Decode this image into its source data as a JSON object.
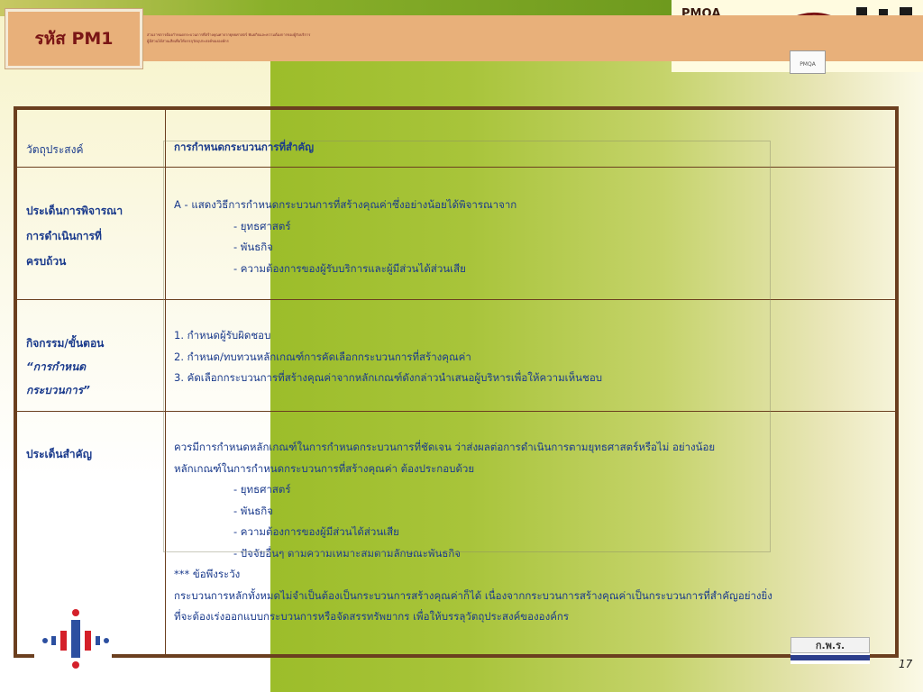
{
  "header": {
    "code_label": "รหัส PM1",
    "tiny_line1": "ส่วนราชการต้องกำหนดกระบวนการที่สร้างคุณค่าจากยุทธศาสตร์ พันธกิจและความต้องการของผู้รับบริการ",
    "tiny_line2": "ผู้มีส่วนได้ส่วนเสียเพื่อให้บรรลุวัตถุประสงค์ขององค์กร",
    "pmqa_label": "PMQA",
    "pmqa_logo_text": "PMQA"
  },
  "table": {
    "rows": [
      {
        "label": [
          "วัตถุประสงค์"
        ],
        "content": [
          "การกำหนดกระบวนการที่สำคัญ"
        ]
      },
      {
        "label": [
          "ประเด็นการพิจารณา",
          "การดำเนินการที่",
          "ครบถ้วน"
        ],
        "intro": "A - แสดงวิธีการกำหนดกระบวนการที่สร้างคุณค่าซึ่งอย่างน้อยได้พิจารณาจาก",
        "bullets": [
          "- ยุทธศาสตร์",
          "- พันธกิจ",
          "- ความต้องการของผู้รับบริการและผู้มีส่วนได้ส่วนเสีย"
        ]
      },
      {
        "label": [
          "กิจกรรม/ขั้นตอน"
        ],
        "label_italic": [
          "“การกำหนด",
          "กระบวนการ”"
        ],
        "steps": [
          "1. กำหนดผู้รับผิดชอบ",
          "2. กำหนด/ทบทวนหลักเกณฑ์การคัดเลือกกระบวนการที่สร้างคุณค่า",
          "3. คัดเลือกกระบวนการที่สร้างคุณค่าจากหลักเกณฑ์ดังกล่าวนำเสนอผู้บริหารเพื่อให้ความเห็นชอบ"
        ]
      },
      {
        "label": [
          "ประเด็นสำคัญ"
        ],
        "line1": "ควรมีการกำหนดหลักเกณฑ์ในการกำหนดกระบวนการที่ชัดเจน ว่าส่งผลต่อการดำเนินการตามยุทธศาสตร์หรือไม่ อย่างน้อย",
        "line2": "หลักเกณฑ์ในการกำหนดกระบวนการที่สร้างคุณค่า ต้องประกอบด้วย",
        "bullets": [
          "- ยุทธศาสตร์",
          "- พันธกิจ",
          "- ความต้องการของผู้มีส่วนได้ส่วนเสีย",
          "- ปัจจัยอื่นๆ ตามความเหมาะสมตามลักษณะพันธกิจ"
        ],
        "caution": "*** ข้อพึงระวัง",
        "line3": "กระบวนการหลักทั้งหมดไม่จำเป็นต้องเป็นกระบวนการสร้างคุณค่าก็ได้ เนื่องจากกระบวนการสร้างคุณค่าเป็นกระบวนการที่สำคัญอย่างยิ่ง",
        "line4": "ที่จะต้องเร่งออกแบบกระบวนการหรือจัดสรรทรัพยากร เพื่อให้บรรลุวัตถุประสงค์ขององค์กร"
      }
    ]
  },
  "footer": {
    "ocsc_text": "ก.พ.ร.",
    "page_number": "17"
  },
  "colors": {
    "accent_orange": "#e8b07a",
    "border_brown": "#6b3f1f",
    "text_blue": "#1a3a8c",
    "code_red": "#7a1515"
  }
}
